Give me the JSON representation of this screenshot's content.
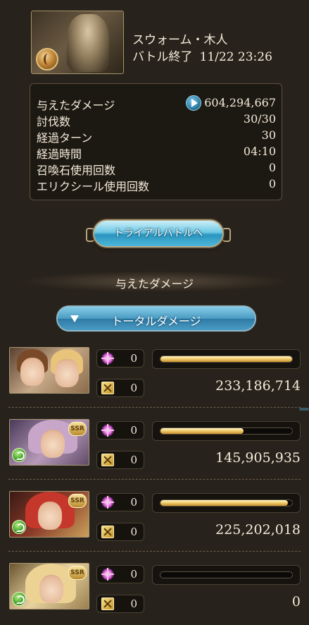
{
  "header": {
    "quest_name": "スウォーム・木人",
    "status": "バトル終了",
    "timestamp": "11/22 23:26"
  },
  "stats": [
    {
      "label": "与えたダメージ",
      "value": "604,294,667",
      "icon": "play-icon"
    },
    {
      "label": "討伐数",
      "value": "30/30"
    },
    {
      "label": "経過ターン",
      "value": "30"
    },
    {
      "label": "経過時間",
      "value": "04:10"
    },
    {
      "label": "召喚石使用回数",
      "value": "0"
    },
    {
      "label": "エリクシール使用回数",
      "value": "0"
    }
  ],
  "trial_button": {
    "label": "トライアルバトルへ"
  },
  "section_title": "与えたダメージ",
  "damage_dropdown": {
    "label": "トータルダメージ"
  },
  "characters": [
    {
      "name": "main-character",
      "ssr": "",
      "skill_count": "0",
      "ougi_count": "0",
      "damage": "233,186,714",
      "ratio": 1.0
    },
    {
      "name": "narmaya",
      "ssr": "SSR",
      "skill_count": "0",
      "ougi_count": "0",
      "damage": "145,905,935",
      "ratio": 0.63
    },
    {
      "name": "red-hair-draph",
      "ssr": "SSR",
      "skill_count": "0",
      "ougi_count": "0",
      "damage": "225,202,018",
      "ratio": 0.97
    },
    {
      "name": "blonde-draph",
      "ssr": "SSR",
      "skill_count": "0",
      "ougi_count": "0",
      "damage": "0",
      "ratio": 0.0
    }
  ],
  "colors": {
    "background": "#27221b",
    "bar_fill": "#f2cf6f",
    "button_blue": "#4eb6d9"
  }
}
